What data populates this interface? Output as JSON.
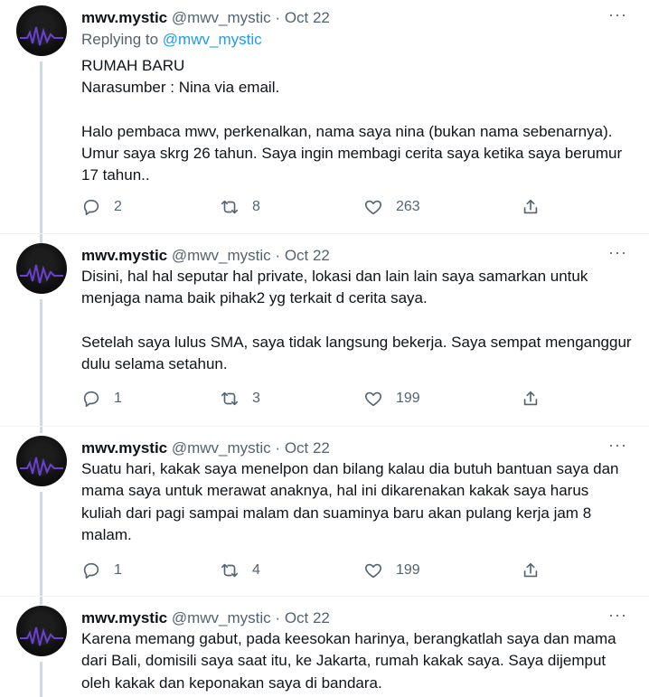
{
  "tweets": [
    {
      "name": "mwv.mystic",
      "handle": "@mwv_mystic",
      "separator": "·",
      "date": "Oct 22",
      "replying_prefix": "Replying to",
      "replying_handle": "@mwv_mystic",
      "paragraphs": [
        "RUMAH BARU",
        "Narasumber : Nina via email.",
        "Halo pembaca mwv, perkenalkan, nama saya nina (bukan nama sebenarnya). Umur saya skrg 26 tahun. Saya ingin membagi cerita saya ketika saya berumur 17 tahun.."
      ],
      "replies": "2",
      "retweets": "8",
      "likes": "263"
    },
    {
      "name": "mwv.mystic",
      "handle": "@mwv_mystic",
      "separator": "·",
      "date": "Oct 22",
      "paragraphs": [
        "Disini, hal hal seputar hal private, lokasi dan lain lain saya samarkan untuk menjaga nama baik pihak2 yg terkait d cerita saya.",
        "Setelah saya lulus SMA, saya tidak langsung bekerja. Saya sempat menganggur dulu selama setahun."
      ],
      "replies": "1",
      "retweets": "3",
      "likes": "199"
    },
    {
      "name": "mwv.mystic",
      "handle": "@mwv_mystic",
      "separator": "·",
      "date": "Oct 22",
      "paragraphs": [
        "Suatu hari, kakak saya menelpon dan bilang kalau dia butuh bantuan saya dan mama saya untuk merawat anaknya, hal ini dikarenakan kakak saya harus kuliah dari pagi sampai malam dan suaminya baru akan pulang kerja jam 8 malam."
      ],
      "replies": "1",
      "retweets": "4",
      "likes": "199"
    },
    {
      "name": "mwv.mystic",
      "handle": "@mwv_mystic",
      "separator": "·",
      "date": "Oct 22",
      "paragraphs": [
        "Karena memang gabut, pada keesokan harinya, berangkatlah saya dan mama dari Bali, domisili saya saat itu, ke Jakarta, rumah kakak saya. Saya dijemput oleh kakak dan keponakan saya di bandara."
      ]
    }
  ],
  "more_icon": "···",
  "icons": {
    "reply": "reply-icon",
    "retweet": "retweet-icon",
    "like": "heart-icon",
    "share": "share-icon",
    "more": "more-options-icon"
  },
  "colors": {
    "text": "#0f1419",
    "secondary": "#536471",
    "link": "#1d9bf0",
    "thread_line": "#cfd9de",
    "divider": "#eff3f4"
  }
}
